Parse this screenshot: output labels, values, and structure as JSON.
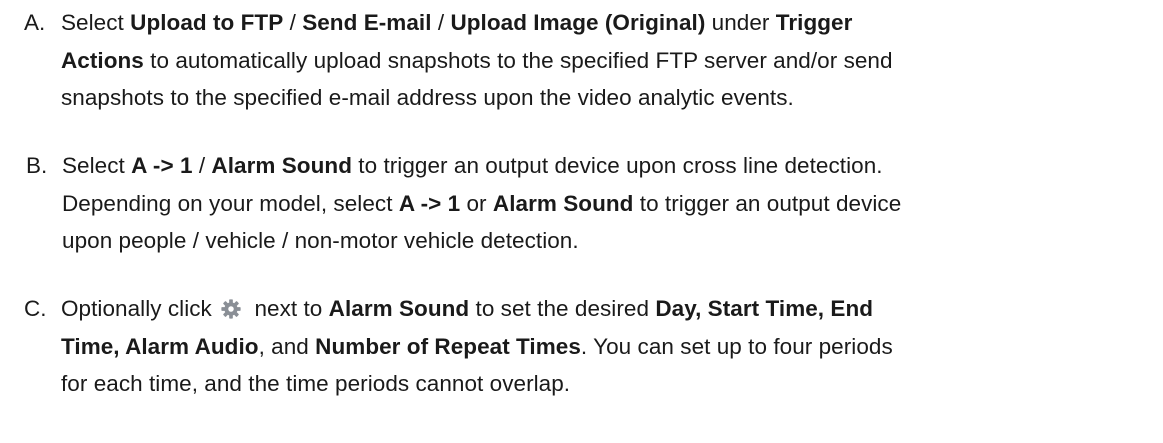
{
  "items": [
    {
      "marker": "A.",
      "runs": [
        {
          "t": "Select ",
          "b": false
        },
        {
          "t": "Upload to FTP",
          "b": true
        },
        {
          "t": " / ",
          "b": false
        },
        {
          "t": "Send E-mail",
          "b": true
        },
        {
          "t": " / ",
          "b": false
        },
        {
          "t": "Upload Image (Original)",
          "b": true
        },
        {
          "t": " under ",
          "b": false
        },
        {
          "t": "Trigger",
          "b": true
        },
        {
          "br": true
        },
        {
          "t": "Actions",
          "b": true
        },
        {
          "t": " to automatically upload snapshots to the specified FTP server and/or send",
          "b": false
        },
        {
          "br": true
        },
        {
          "t": "snapshots to the specified e-mail address upon the video analytic events.",
          "b": false
        }
      ]
    },
    {
      "marker": "B.",
      "runs": [
        {
          "t": "Select ",
          "b": false
        },
        {
          "t": "A -> 1",
          "b": true
        },
        {
          "t": " / ",
          "b": false
        },
        {
          "t": "Alarm Sound",
          "b": true
        },
        {
          "t": " to trigger an output device upon cross line detection.",
          "b": false
        },
        {
          "br": true
        },
        {
          "t": "Depending on your model, select ",
          "b": false
        },
        {
          "t": "A -> 1",
          "b": true
        },
        {
          "t": " or ",
          "b": false
        },
        {
          "t": "Alarm Sound",
          "b": true
        },
        {
          "t": " to trigger an output device",
          "b": false
        },
        {
          "br": true
        },
        {
          "t": "upon people / vehicle / non-motor vehicle detection.",
          "b": false
        }
      ]
    },
    {
      "marker": "C.",
      "runs": [
        {
          "t": "Optionally click ",
          "b": false
        },
        {
          "icon": "gear-icon"
        },
        {
          "t": " next to ",
          "b": false
        },
        {
          "t": "Alarm Sound",
          "b": true
        },
        {
          "t": " to set the desired ",
          "b": false
        },
        {
          "t": "Day, Start Time, End",
          "b": true
        },
        {
          "br": true
        },
        {
          "t": "Time, Alarm Audio",
          "b": true
        },
        {
          "t": ", and ",
          "b": false
        },
        {
          "t": "Number of Repeat Times",
          "b": true
        },
        {
          "t": ". You can set up to four periods",
          "b": false
        },
        {
          "br": true
        },
        {
          "t": "for each time, and the time periods cannot overlap.",
          "b": false
        }
      ]
    }
  ],
  "colors": {
    "text": "#1a1a1a",
    "icon": "#8a8f96"
  }
}
